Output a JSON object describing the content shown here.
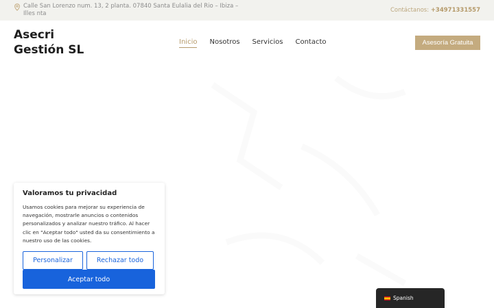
{
  "topbar": {
    "address": "Calle San Lorenzo num. 13, 2 planta. 07840 Santa Eulalia del Rio – Ibiza – Illes nta",
    "contact_label": "Contáctanos:",
    "phone": "+34971331557"
  },
  "header": {
    "logo_line1": "Asecri",
    "logo_line2": "Gestión SL",
    "nav": [
      "Inicio",
      "Nosotros",
      "Servicios",
      "Contacto"
    ],
    "cta": "Asesoría Gratuita"
  },
  "cookie": {
    "title": "Valoramos tu privacidad",
    "body": "Usamos cookies para mejorar su experiencia de navegación, mostrarle anuncios o contenidos personalizados y analizar nuestro tráfico. Al hacer clic en \"Aceptar todo\" usted da su consentimiento a nuestro uso de las cookies.",
    "customize": "Personalizar",
    "reject": "Rechazar todo",
    "accept": "Aceptar todo"
  },
  "language": {
    "label": "Spanish"
  },
  "colors": {
    "accent": "#c4ab7f",
    "cookie_blue": "#1863dc",
    "topbar_bg": "#f2f2ee"
  }
}
